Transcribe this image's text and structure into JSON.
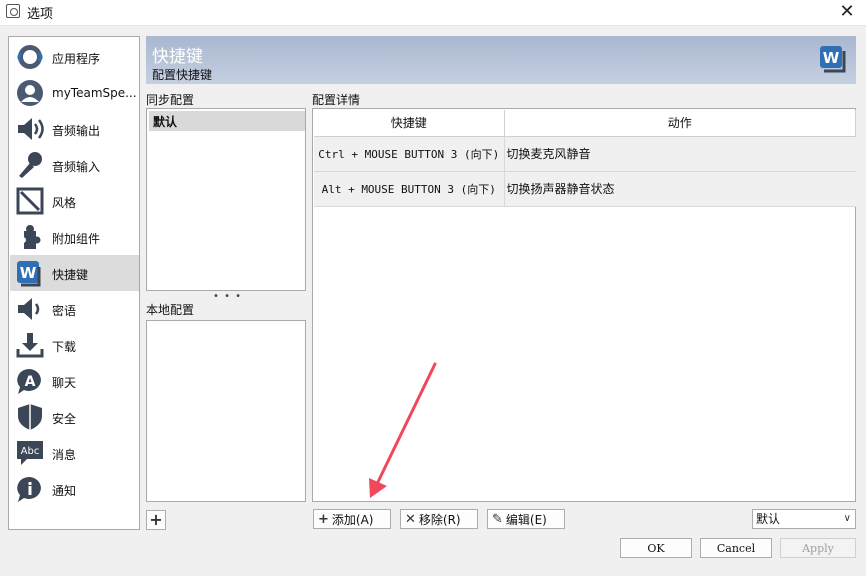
{
  "window": {
    "title": "选项",
    "close_glyph": "✕"
  },
  "sidebar": {
    "items": [
      {
        "label": "应用程序",
        "icon": "application-icon"
      },
      {
        "label": "myTeamSpe...",
        "icon": "user-avatar-icon"
      },
      {
        "label": "音频输出",
        "icon": "speaker-icon"
      },
      {
        "label": "音频输入",
        "icon": "microphone-icon"
      },
      {
        "label": "风格",
        "icon": "design-icon"
      },
      {
        "label": "附加组件",
        "icon": "puzzle-icon"
      },
      {
        "label": "快捷键",
        "icon": "hotkey-icon"
      },
      {
        "label": "密语",
        "icon": "whisper-icon"
      },
      {
        "label": "下载",
        "icon": "download-icon"
      },
      {
        "label": "聊天",
        "icon": "chat-icon"
      },
      {
        "label": "安全",
        "icon": "shield-icon"
      },
      {
        "label": "消息",
        "icon": "messages-icon"
      },
      {
        "label": "通知",
        "icon": "notification-icon"
      }
    ],
    "active_index": 6
  },
  "header": {
    "title": "快捷键",
    "subtitle": "配置快捷键"
  },
  "sync": {
    "label": "同步配置",
    "items": [
      "默认"
    ]
  },
  "splitter": "• • •",
  "local": {
    "label": "本地配置"
  },
  "details": {
    "label": "配置详情",
    "columns": [
      "快捷键",
      "动作"
    ],
    "rows": [
      {
        "key": "Ctrl + MOUSE BUTTON 3 (向下)",
        "action": "切换麦克风静音"
      },
      {
        "key": "Alt + MOUSE BUTTON 3 (向下)",
        "action": "切换扬声器静音状态"
      }
    ]
  },
  "buttons": {
    "add_profile": "+",
    "add": "添加(A)",
    "remove": "移除(R)",
    "edit": "编辑(E)",
    "ok": "OK",
    "cancel": "Cancel",
    "apply": "Apply"
  },
  "profile_select": {
    "value": "默认"
  },
  "colors": {
    "header_gradient_top": "#a9b7cf",
    "header_gradient_bottom": "#c4cfe1",
    "active_nav": "#dcdcdc",
    "annotation_arrow": "#f0475d"
  }
}
